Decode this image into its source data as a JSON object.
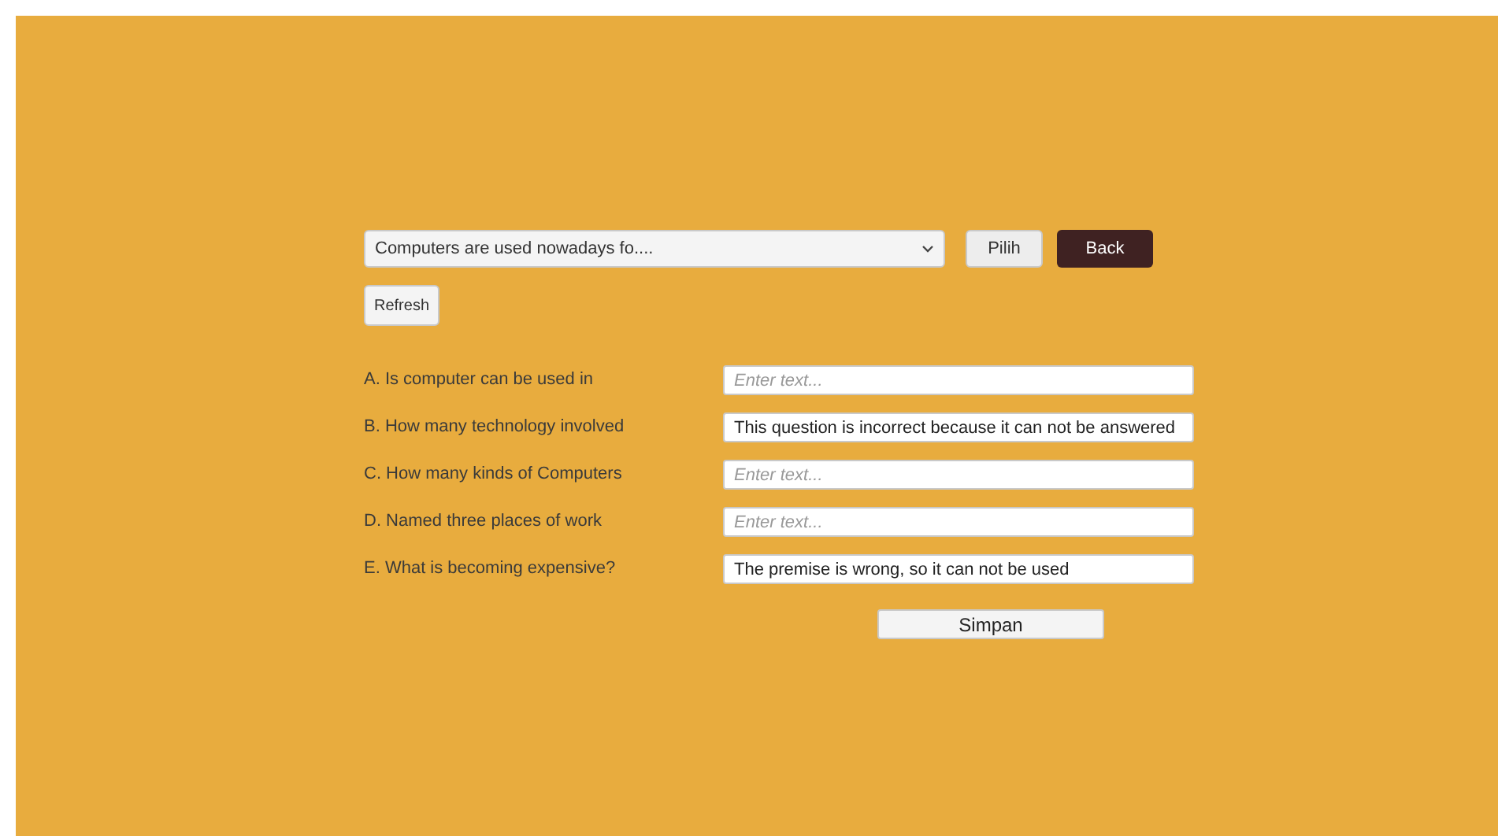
{
  "question_select": {
    "value": "Computers are used nowadays fo...."
  },
  "buttons": {
    "choose": "Pilih",
    "back": "Back",
    "refresh": "Refresh",
    "save": "Simpan"
  },
  "questions": [
    {
      "label": "A. Is computer can be used in",
      "placeholder": "Enter text..."
    },
    {
      "label": "B. How many technology involved",
      "value": "This question is incorrect because it can not be answered"
    },
    {
      "label": "C. How many kinds of Computers",
      "placeholder": "Enter text..."
    },
    {
      "label": "D. Named three places of work",
      "placeholder": "Enter text..."
    },
    {
      "label": "E. What is becoming expensive?",
      "value": "The premise is wrong, so it can not be used"
    }
  ]
}
